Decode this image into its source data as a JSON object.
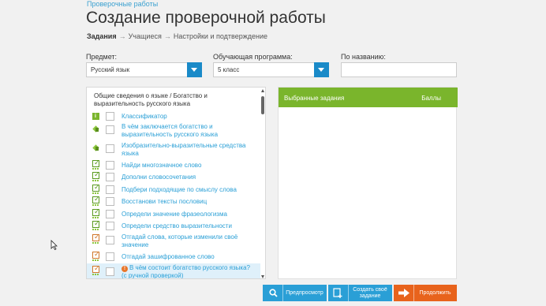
{
  "breadcrumb": "Проверочные работы",
  "page_title": "Создание проверочной работы",
  "steps": [
    {
      "label": "Задания",
      "active": true
    },
    {
      "label": "Учащиеся",
      "active": false
    },
    {
      "label": "Настройки и подтверждение",
      "active": false
    }
  ],
  "step_arrow": "→",
  "filters": {
    "subject_label": "Предмет:",
    "subject_value": "Русский язык",
    "program_label": "Обучающая программа:",
    "program_value": "5 класс",
    "name_label": "По названию:",
    "name_value": ""
  },
  "tasks": {
    "category_title": "Общие сведения о языке / Богатство и выразительность русского языка",
    "items": [
      {
        "icon": "info-icon",
        "label": "Классификатор"
      },
      {
        "icon": "theory-cube-icon",
        "label": "В чём заключается богатство и выразительность русского языка"
      },
      {
        "icon": "theory-cube-icon",
        "label": "Изобразительно-выразительные средства языка"
      },
      {
        "icon": "exercise-check-icon",
        "label": "Найди многозначное слово"
      },
      {
        "icon": "exercise-check-icon",
        "label": "Дополни словосочетания"
      },
      {
        "icon": "exercise-check-icon",
        "label": "Подбери подходящие по смыслу слова"
      },
      {
        "icon": "exercise-check-icon",
        "label": "Восстанови тексты пословиц"
      },
      {
        "icon": "exercise-check-icon",
        "label": "Определи значение фразеологизма"
      },
      {
        "icon": "exercise-check-icon",
        "label": "Определи средство выразительности"
      },
      {
        "icon": "exercise-check-orange-icon",
        "label": "Отгадай слова, которые изменили своё значение"
      },
      {
        "icon": "exercise-check-orange-icon",
        "label": "Отгадай зашифрованное слово"
      },
      {
        "icon": "exercise-check-orange-icon",
        "label": "В чём состоит богатство русского языка? (с ручной проверкой)",
        "warning": "!"
      }
    ]
  },
  "selected": {
    "header_tasks": "Выбранные задания",
    "header_points": "Баллы"
  },
  "buttons": {
    "preview": "Предпросмотр",
    "create": "Создать своё задание",
    "continue": "Продолжить"
  },
  "colors": {
    "accent_blue": "#2a9fd6",
    "accent_green": "#7ab52c",
    "accent_orange": "#e8631c"
  }
}
